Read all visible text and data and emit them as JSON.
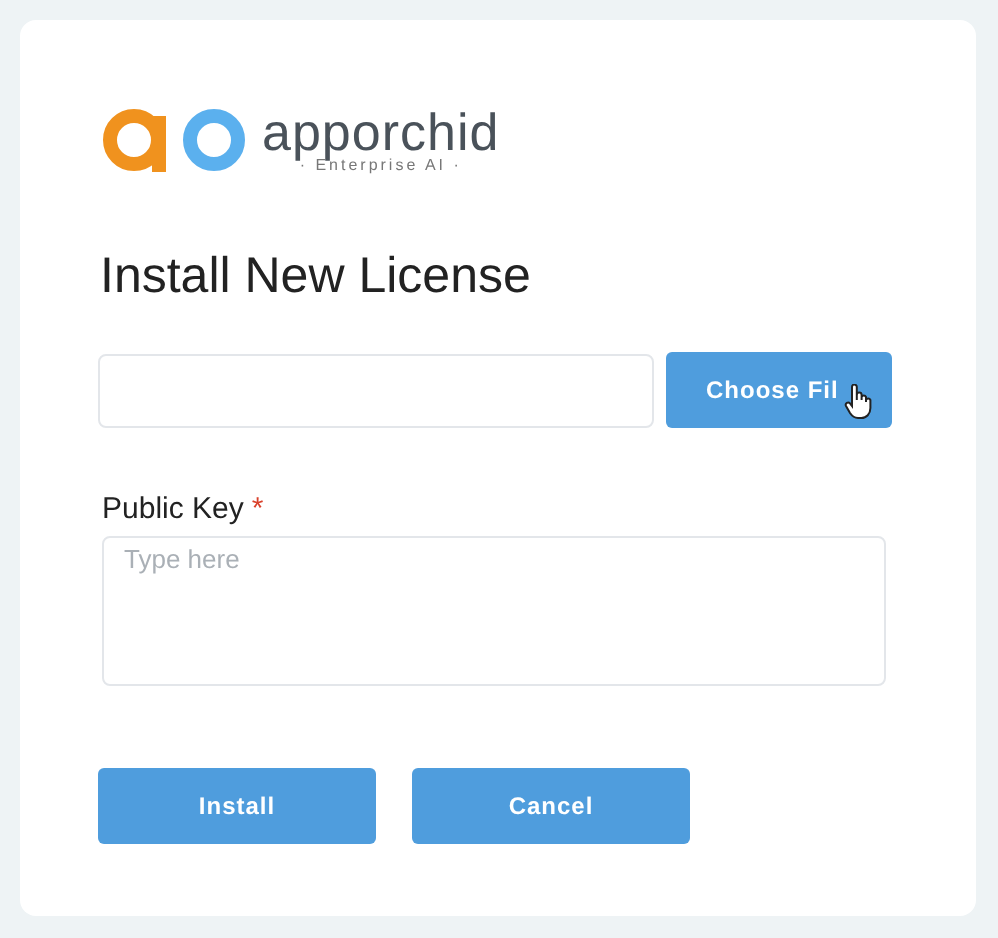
{
  "logo": {
    "name": "apporchid",
    "tagline": "· Enterprise AI ·"
  },
  "title": "Install New License",
  "file_picker": {
    "button": "Choose Fil"
  },
  "public_key": {
    "label": "Public Key",
    "required_mark": "*",
    "placeholder": "Type here"
  },
  "buttons": [
    {
      "label": "Install"
    },
    {
      "label": "Cancel"
    }
  ]
}
